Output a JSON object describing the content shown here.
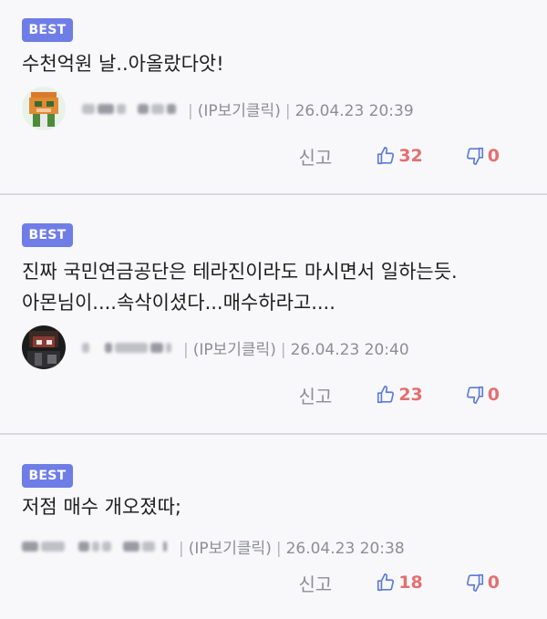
{
  "comments": [
    {
      "badge": "BEST",
      "lines": [
        "수천억원 날..아올랐다앗!"
      ],
      "ip_label": "(IP보기클릭)",
      "timestamp": "26.04.23 20:39",
      "report_label": "신고",
      "likes": "32",
      "dislikes": "0",
      "avatar_icon": "pixel-avatar-orange"
    },
    {
      "badge": "BEST",
      "lines": [
        "진짜 국민연금공단은 테라진이라도 마시면서 일하는듯.",
        "아몬님이....속삭이셨다...매수하라고...."
      ],
      "ip_label": "(IP보기클릭)",
      "timestamp": "26.04.23 20:40",
      "report_label": "신고",
      "likes": "23",
      "dislikes": "0",
      "avatar_icon": "dark-character-avatar"
    },
    {
      "badge": "BEST",
      "lines": [
        "저점 매수 개오졌따;"
      ],
      "ip_label": "(IP보기클릭)",
      "timestamp": "26.04.23 20:38",
      "report_label": "신고",
      "likes": "18",
      "dislikes": "0",
      "avatar_icon": ""
    }
  ],
  "colors": {
    "badge": "#6f7de6",
    "vote_icon": "#5b7bd8",
    "vote_count": "#e46f71",
    "meta_text": "#8d8e94"
  }
}
